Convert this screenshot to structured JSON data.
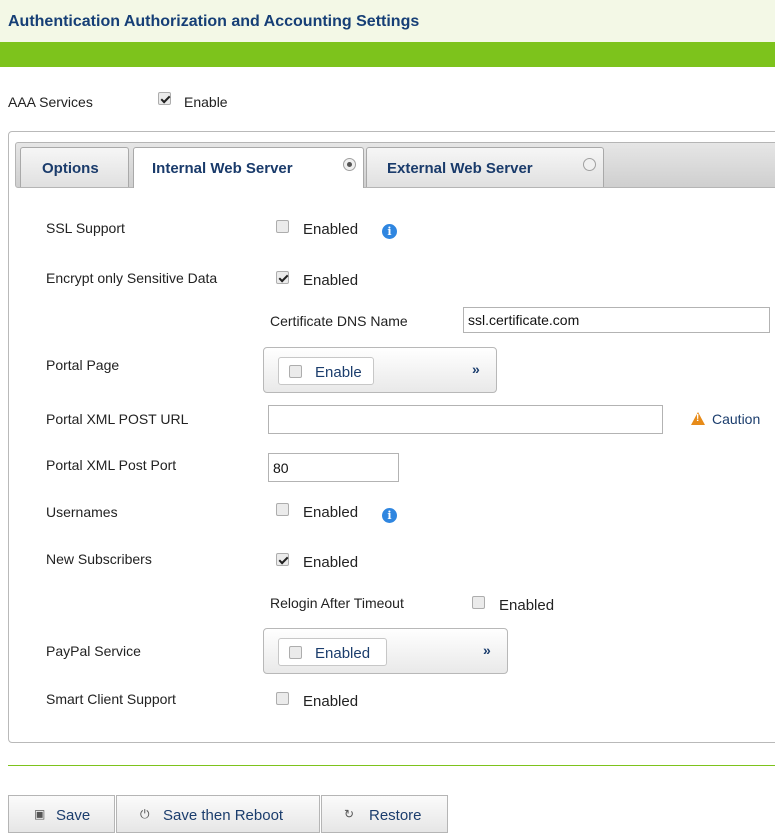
{
  "page": {
    "title": "Authentication Authorization and Accounting Settings"
  },
  "aaa": {
    "label": "AAA Services",
    "enable_label": "Enable",
    "checked": true
  },
  "tabs": [
    {
      "label": "Options"
    },
    {
      "label": "Internal Web Server",
      "selected": true
    },
    {
      "label": "External Web Server",
      "selected": false
    }
  ],
  "form": {
    "ssl_support": {
      "label": "SSL Support",
      "value_label": "Enabled",
      "checked": false
    },
    "encrypt_sensitive": {
      "label": "Encrypt only Sensitive Data",
      "value_label": "Enabled",
      "checked": true
    },
    "cert_dns": {
      "label": "Certificate DNS Name",
      "value": "ssl.certificate.com"
    },
    "portal_page": {
      "label": "Portal Page",
      "button_label": "Enable",
      "arrows": "»"
    },
    "portal_xml_post_url": {
      "label": "Portal XML POST URL",
      "value": "",
      "caution": "Caution"
    },
    "portal_xml_post_port": {
      "label": "Portal XML Post Port",
      "value": "80"
    },
    "usernames": {
      "label": "Usernames",
      "value_label": "Enabled",
      "checked": false
    },
    "new_subscribers": {
      "label": "New Subscribers",
      "value_label": "Enabled",
      "checked": true
    },
    "relogin_after_timeout": {
      "label": "Relogin After Timeout",
      "value_label": "Enabled",
      "checked": false
    },
    "paypal_service": {
      "label": "PayPal Service",
      "button_label": "Enabled",
      "arrows": "»"
    },
    "smart_client_support": {
      "label": "Smart Client Support",
      "value_label": "Enabled",
      "checked": false
    }
  },
  "buttons": {
    "save": "Save",
    "save_reboot": "Save then Reboot",
    "restore": "Restore"
  },
  "icons": {
    "save": "floppy-disk-icon",
    "save_reboot": "power-icon",
    "restore": "undo-icon",
    "info": "info-icon",
    "caution": "warning-icon"
  },
  "colors": {
    "accent_green": "#7dc31c",
    "title_blue": "#163f76",
    "info_blue": "#2f86e0",
    "caution_orange": "#e78b19"
  }
}
